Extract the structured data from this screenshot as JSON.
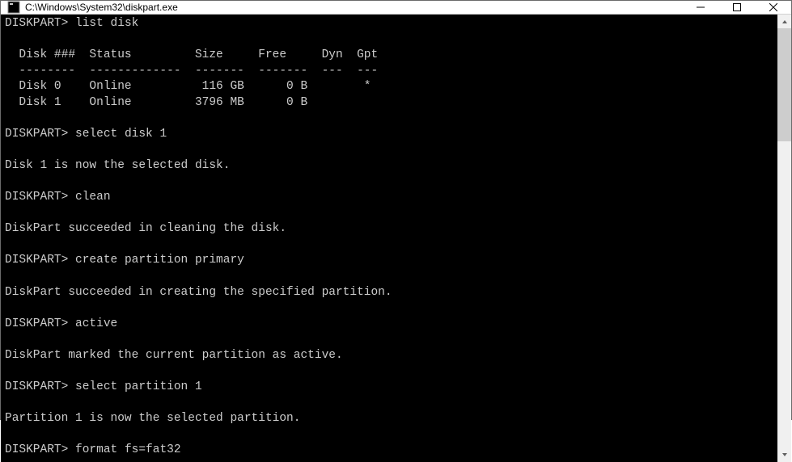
{
  "window": {
    "title": "C:\\Windows\\System32\\diskpart.exe"
  },
  "terminal": {
    "prompt": "DISKPART>",
    "commands": {
      "list_disk": "list disk",
      "select_disk": "select disk 1",
      "clean": "clean",
      "create_partition": "create partition primary",
      "active": "active",
      "select_partition": "select partition 1",
      "format": "format fs=fat32"
    },
    "table": {
      "header": "  Disk ###  Status         Size     Free     Dyn  Gpt",
      "divider": "  --------  -------------  -------  -------  ---  ---",
      "rows": [
        "  Disk 0    Online          116 GB      0 B        *",
        "  Disk 1    Online         3796 MB      0 B"
      ]
    },
    "responses": {
      "selected_disk": "Disk 1 is now the selected disk.",
      "clean_success": "DiskPart succeeded in cleaning the disk.",
      "partition_created": "DiskPart succeeded in creating the specified partition.",
      "active_marked": "DiskPart marked the current partition as active.",
      "partition_selected": "Partition 1 is now the selected partition."
    }
  }
}
